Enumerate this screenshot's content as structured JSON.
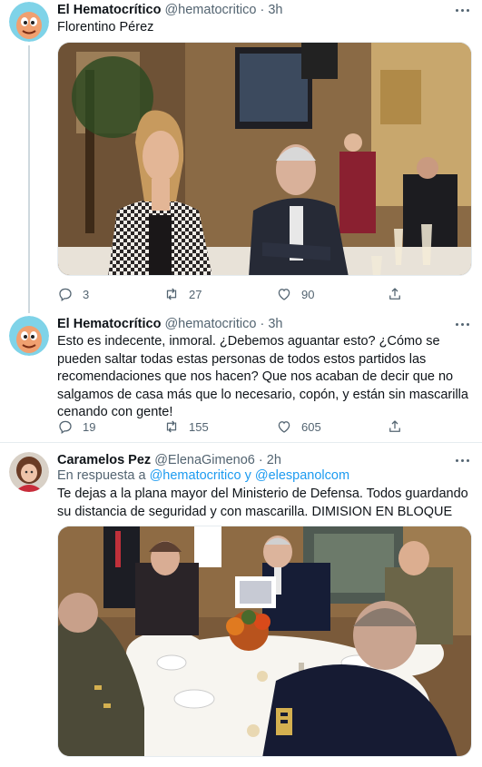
{
  "tweets": [
    {
      "name": "El Hematocrítico",
      "handle": "@hematocritico",
      "dot": "·",
      "time": "3h",
      "text": "Florentino Pérez",
      "stats": {
        "replies": "3",
        "retweets": "27",
        "likes": "90"
      }
    },
    {
      "name": "El Hematocrítico",
      "handle": "@hematocritico",
      "dot": "·",
      "time": "3h",
      "text": "Esto es indecente, inmoral. ¿Debemos aguantar esto? ¿Cómo se pueden saltar todas estas personas de todos estos partidos las recomendaciones que nos hacen? Que nos acaban de decir que no salgamos de casa más que lo necesario, copón, y están sin mascarilla cenando con gente!",
      "stats": {
        "replies": "19",
        "retweets": "155",
        "likes": "605"
      }
    },
    {
      "name": "Caramelos Pez",
      "handle": "@ElenaGimeno6",
      "dot": "·",
      "time": "2h",
      "reply_prefix": "En respuesta a",
      "reply_mention_1": "@hematocritico",
      "reply_joiner": "y",
      "reply_mention_2": "@elespanolcom",
      "text": "Te dejas a la plana mayor del Ministerio de Defensa. Todos guardando su distancia de seguridad y con mascarilla. DIMISION EN BLOQUE"
    }
  ],
  "colors": {
    "text": "#0f1419",
    "secondary": "#536471",
    "link": "#1d9bf0",
    "border": "#e6ecf0"
  }
}
